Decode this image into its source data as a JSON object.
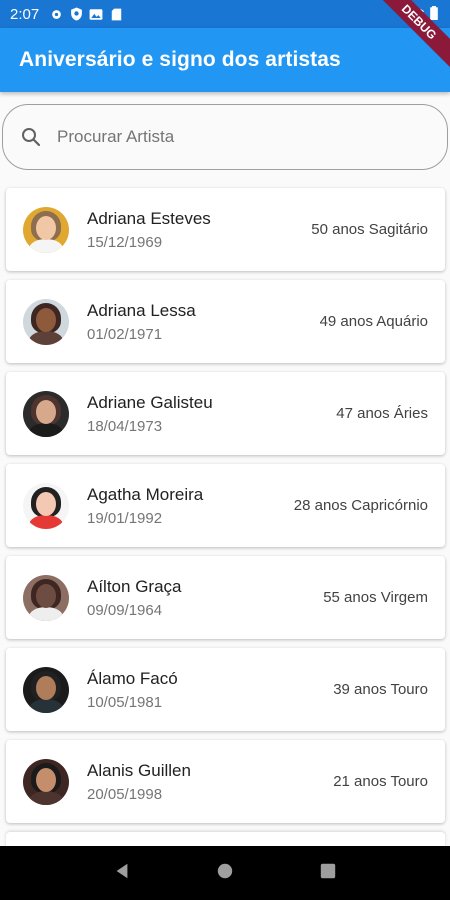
{
  "status_bar": {
    "time": "2:07",
    "icons_left": [
      "gear-icon",
      "shield-icon",
      "image-icon",
      "sd-card-icon"
    ],
    "icons_right": [
      "wifi-icon",
      "signal-icon",
      "battery-icon"
    ]
  },
  "debug_banner": "DEBUG",
  "app_bar": {
    "title": "Aniversário e signo dos artistas"
  },
  "search": {
    "placeholder": "Procurar Artista",
    "value": ""
  },
  "artists": [
    {
      "name": "Adriana Esteves",
      "birthdate": "15/12/1969",
      "age_sign": "50 anos Sagitário",
      "colors": {
        "bg": "#e0a830",
        "hair": "#8d6e4e",
        "skin": "#f1c7a6",
        "shirt": "#f5f5f5"
      }
    },
    {
      "name": "Adriana Lessa",
      "birthdate": "01/02/1971",
      "age_sign": "49 anos Aquário",
      "colors": {
        "bg": "#cfd8dc",
        "hair": "#3e2723",
        "skin": "#8d5a3b",
        "shirt": "#5d4037"
      }
    },
    {
      "name": "Adriane Galisteu",
      "birthdate": "18/04/1973",
      "age_sign": "47 anos Áries",
      "colors": {
        "bg": "#2b2b2b",
        "hair": "#4e342e",
        "skin": "#d7a98c",
        "shirt": "#1b1b1b"
      }
    },
    {
      "name": "Agatha Moreira",
      "birthdate": "19/01/1992",
      "age_sign": "28 anos Capricórnio",
      "colors": {
        "bg": "#f5f5f5",
        "hair": "#212121",
        "skin": "#f3c9b3",
        "shirt": "#e53935"
      }
    },
    {
      "name": "Aílton Graça",
      "birthdate": "09/09/1964",
      "age_sign": "55 anos Virgem",
      "colors": {
        "bg": "#8d6e63",
        "hair": "#3e2723",
        "skin": "#6d4c41",
        "shirt": "#eeeeee"
      }
    },
    {
      "name": "Álamo Facó",
      "birthdate": "10/05/1981",
      "age_sign": "39 anos Touro",
      "colors": {
        "bg": "#1b1b1b",
        "hair": "#212121",
        "skin": "#b07d5b",
        "shirt": "#263238"
      }
    },
    {
      "name": "Alanis Guillen",
      "birthdate": "20/05/1998",
      "age_sign": "21 anos Touro",
      "colors": {
        "bg": "#3e2723",
        "hair": "#1b1b1b",
        "skin": "#c48e6c",
        "shirt": "#4e342e"
      }
    }
  ],
  "nav": [
    "back-icon",
    "home-icon",
    "recents-icon"
  ]
}
